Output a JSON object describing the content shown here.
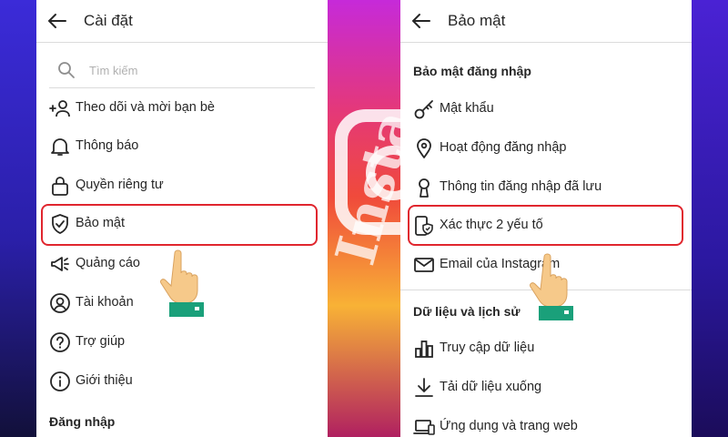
{
  "left_screen": {
    "title": "Cài đặt",
    "search": {
      "placeholder": "Tìm kiếm"
    },
    "items": [
      {
        "label": "Theo dõi và mời bạn bè",
        "icon": "add-person-icon"
      },
      {
        "label": "Thông báo",
        "icon": "bell-icon"
      },
      {
        "label": "Quyền riêng tư",
        "icon": "lock-icon"
      },
      {
        "label": "Bảo mật",
        "icon": "shield-check-icon",
        "highlighted": true
      },
      {
        "label": "Quảng cáo",
        "icon": "megaphone-icon"
      },
      {
        "label": "Tài khoản",
        "icon": "account-icon"
      },
      {
        "label": "Trợ giúp",
        "icon": "help-icon"
      },
      {
        "label": "Giới thiệu",
        "icon": "info-icon"
      }
    ],
    "section_login": "Đăng nhập"
  },
  "right_screen": {
    "title": "Bảo mật",
    "section_login_security": "Bảo mật đăng nhập",
    "login_items": [
      {
        "label": "Mật khẩu",
        "icon": "key-icon"
      },
      {
        "label": "Hoạt động đăng nhập",
        "icon": "location-pin-icon"
      },
      {
        "label": "Thông tin đăng nhập đã lưu",
        "icon": "keyhole-icon"
      },
      {
        "label": "Xác thực 2 yếu tố",
        "icon": "phone-shield-icon",
        "highlighted": true
      },
      {
        "label": "Email của Instagram",
        "icon": "mail-icon"
      }
    ],
    "section_data_history": "Dữ liệu và lịch sử",
    "data_items": [
      {
        "label": "Truy cập dữ liệu",
        "icon": "bar-chart-icon"
      },
      {
        "label": "Tải dữ liệu xuống",
        "icon": "download-icon"
      },
      {
        "label": "Ứng dụng và trang web",
        "icon": "laptop-icon"
      }
    ]
  },
  "colors": {
    "highlight": "#e0262e",
    "text": "#262626",
    "divider": "#dbdbdb",
    "cuff": "#1aa07a",
    "skin": "#f6c98a"
  }
}
